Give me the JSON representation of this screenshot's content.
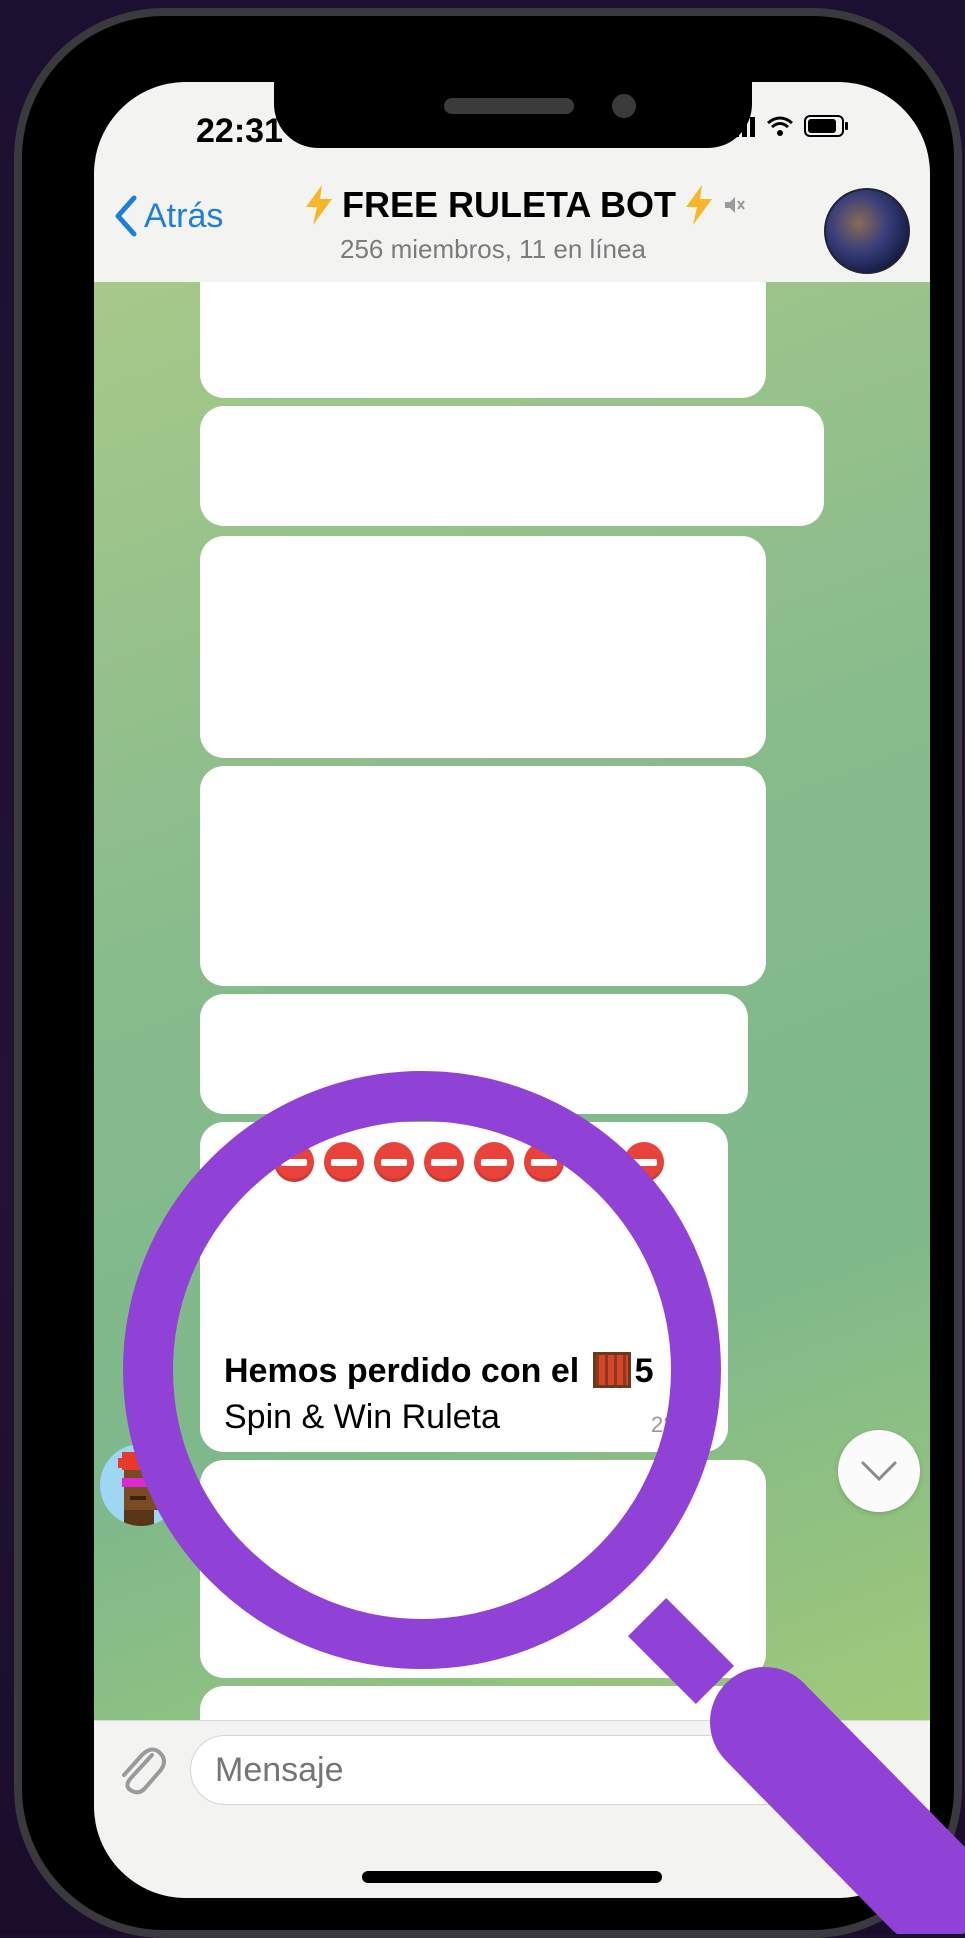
{
  "status_bar": {
    "time": "22:31"
  },
  "header": {
    "back_label": "Atrás",
    "title": "FREE RULETA BOT",
    "subtitle": "256 miembros, 11 en línea"
  },
  "message": {
    "emoji_row_count": 9,
    "bold_prefix": "Hemos perdido con el",
    "bold_suffix": "5",
    "plain_text": "Spin & Win  Ruleta",
    "time": "22:25"
  },
  "composer": {
    "placeholder": "Mensaje"
  },
  "colors": {
    "accent": "#1f7ed6",
    "magnifier": "#9041d6"
  }
}
